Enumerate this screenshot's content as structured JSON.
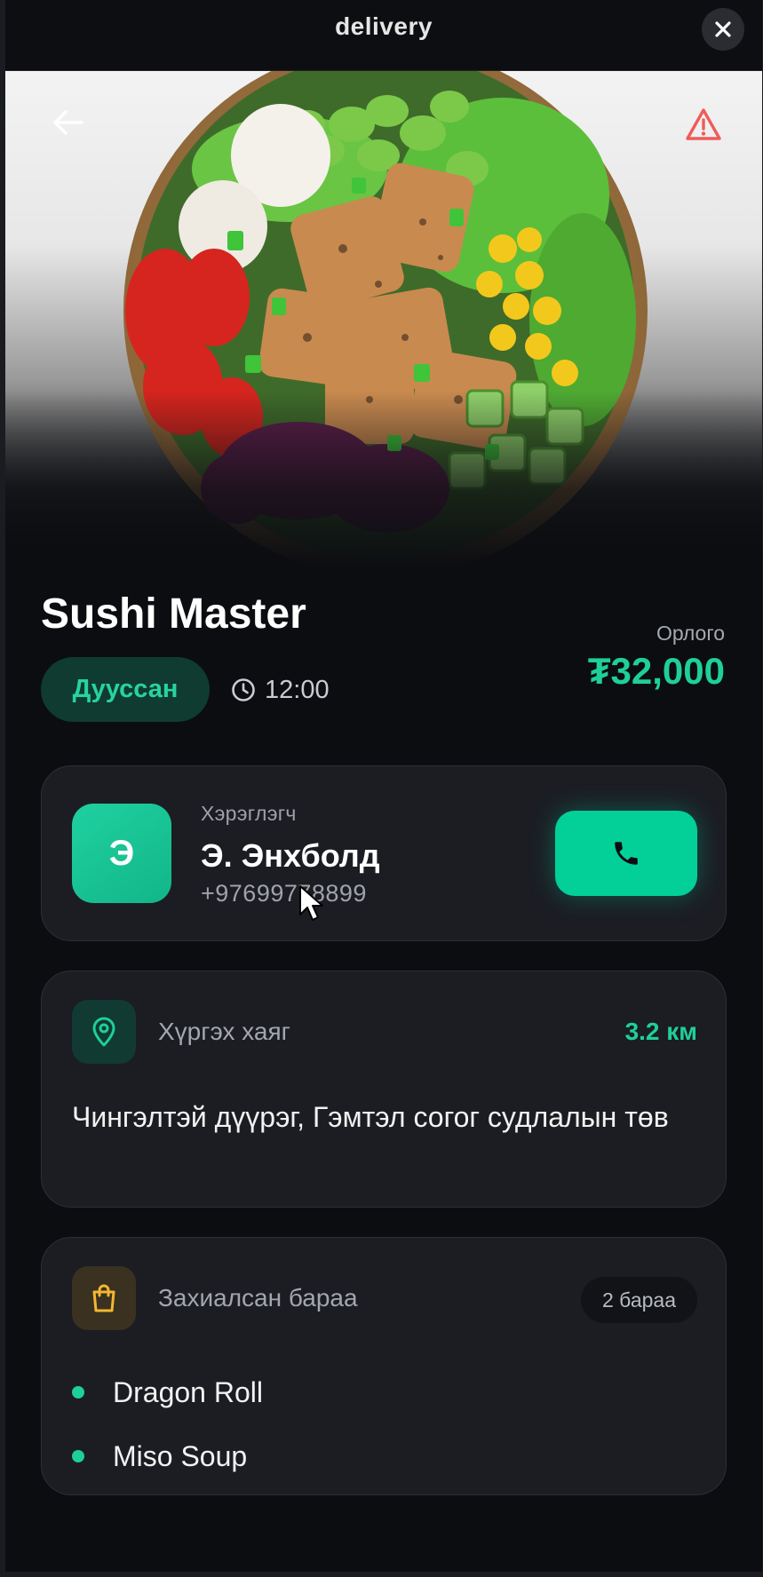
{
  "window": {
    "title": "delivery",
    "close_icon": "close-icon"
  },
  "hero": {
    "back_icon": "arrow-left-icon",
    "report_icon": "warning-triangle-icon",
    "warning_color": "#f05a5a"
  },
  "order": {
    "restaurant": "Sushi Master",
    "status": "Дууссан",
    "time": "12:00",
    "earnings_label": "Орлого",
    "earnings_value": "₮32,000"
  },
  "customer": {
    "label": "Хэрэглэгч",
    "initial": "Э",
    "name": "Э. Энхболд",
    "phone": "+97699778899",
    "call_icon": "phone-icon"
  },
  "address": {
    "label": "Хүргэх хаяг",
    "distance": "3.2 км",
    "text": "Чингэлтэй дүүрэг, Гэмтэл согог судлалын төв",
    "icon": "map-pin-icon"
  },
  "items": {
    "label": "Захиалсан бараа",
    "count": "2 бараа",
    "icon": "shopping-bag-icon",
    "list": [
      {
        "name": "Dragon Roll"
      },
      {
        "name": "Miso Soup"
      }
    ]
  },
  "colors": {
    "accent": "#03cf99",
    "background": "#0b0d11",
    "card": "#1b1d23",
    "bag_accent": "#f2b731"
  }
}
